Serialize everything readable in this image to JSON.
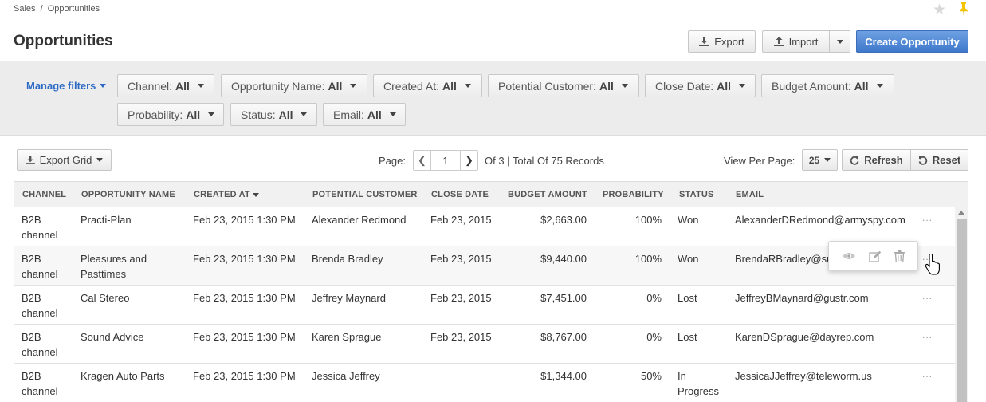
{
  "breadcrumb": {
    "parent": "Sales",
    "separator": "/",
    "current": "Opportunities"
  },
  "page": {
    "title": "Opportunities"
  },
  "header_actions": {
    "export_label": "Export",
    "import_label": "Import",
    "create_label": "Create Opportunity"
  },
  "filters": {
    "manage_label": "Manage filters",
    "items": [
      {
        "name": "Channel:",
        "value": "All"
      },
      {
        "name": "Opportunity Name:",
        "value": "All"
      },
      {
        "name": "Created At:",
        "value": "All"
      },
      {
        "name": "Potential Customer:",
        "value": "All"
      },
      {
        "name": "Close Date:",
        "value": "All"
      },
      {
        "name": "Budget Amount:",
        "value": "All"
      },
      {
        "name": "Probability:",
        "value": "All"
      },
      {
        "name": "Status:",
        "value": "All"
      },
      {
        "name": "Email:",
        "value": "All"
      }
    ]
  },
  "toolbar": {
    "export_grid_label": "Export Grid",
    "page_label": "Page:",
    "page_number": "1",
    "page_summary": "Of 3 | Total Of 75 Records",
    "view_per_page_label": "View Per Page:",
    "per_page_value": "25",
    "refresh_label": "Refresh",
    "reset_label": "Reset"
  },
  "grid": {
    "columns": [
      "CHANNEL",
      "OPPORTUNITY NAME",
      "CREATED AT",
      "POTENTIAL CUSTOMER",
      "CLOSE DATE",
      "BUDGET AMOUNT",
      "PROBABILITY",
      "STATUS",
      "EMAIL"
    ],
    "rows": [
      {
        "channel": "B2B channel",
        "name": "Practi-Plan",
        "created": "Feb 23, 2015 1:30 PM",
        "customer": "Alexander Redmond",
        "close": "Feb 23, 2015",
        "budget": "$2,663.00",
        "probability": "100%",
        "status": "Won",
        "email": "AlexanderDRedmond@armyspy.com"
      },
      {
        "channel": "B2B channel",
        "name": "Pleasures and Pasttimes",
        "created": "Feb 23, 2015 1:30 PM",
        "customer": "Brenda Bradley",
        "close": "Feb 23, 2015",
        "budget": "$9,440.00",
        "probability": "100%",
        "status": "Won",
        "email": "BrendaRBradley@su"
      },
      {
        "channel": "B2B channel",
        "name": "Cal Stereo",
        "created": "Feb 23, 2015 1:30 PM",
        "customer": "Jeffrey Maynard",
        "close": "Feb 23, 2015",
        "budget": "$7,451.00",
        "probability": "0%",
        "status": "Lost",
        "email": "JeffreyBMaynard@gustr.com"
      },
      {
        "channel": "B2B channel",
        "name": "Sound Advice",
        "created": "Feb 23, 2015 1:30 PM",
        "customer": "Karen Sprague",
        "close": "Feb 23, 2015",
        "budget": "$8,767.00",
        "probability": "0%",
        "status": "Lost",
        "email": "KarenDSprague@dayrep.com"
      },
      {
        "channel": "B2B channel",
        "name": "Kragen Auto Parts",
        "created": "Feb 23, 2015 1:30 PM",
        "customer": "Jessica Jeffrey",
        "close": "",
        "budget": "$1,344.00",
        "probability": "50%",
        "status": "In Progress",
        "email": "JessicaJJeffrey@teleworm.us"
      }
    ],
    "row_actions_label": "..."
  },
  "colors": {
    "accent": "#2e6bc6",
    "primary_button": "#4a84d6",
    "pin": "#f5c400"
  }
}
